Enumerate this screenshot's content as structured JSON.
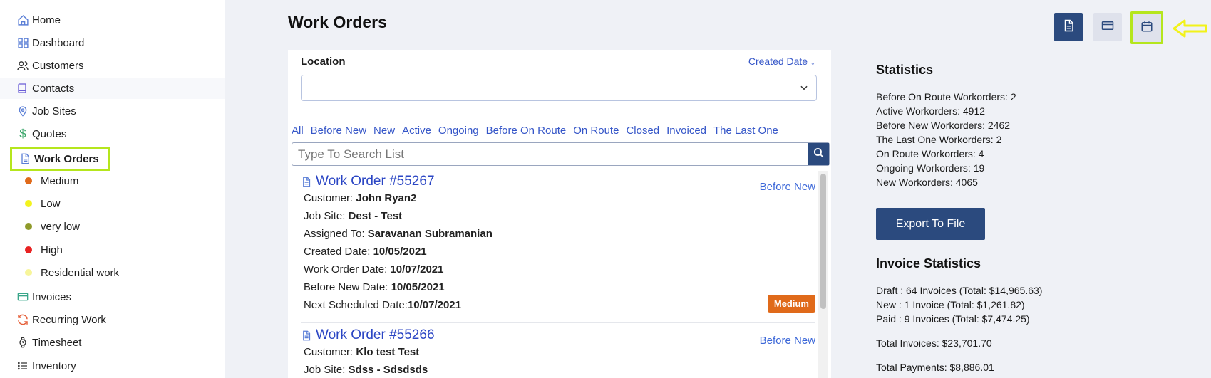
{
  "sidebar": {
    "items": [
      {
        "label": "Home",
        "icon": "home-icon"
      },
      {
        "label": "Dashboard",
        "icon": "dashboard-icon"
      },
      {
        "label": "Customers",
        "icon": "users-icon"
      },
      {
        "label": "Contacts",
        "icon": "book-icon"
      },
      {
        "label": "Job Sites",
        "icon": "map-pin-icon"
      },
      {
        "label": "Quotes",
        "icon": "dollar-icon"
      },
      {
        "label": "Work Orders",
        "icon": "document-icon"
      },
      {
        "label": "Invoices",
        "icon": "credit-card-icon"
      },
      {
        "label": "Recurring Work",
        "icon": "refresh-icon"
      },
      {
        "label": "Timesheet",
        "icon": "watch-icon"
      },
      {
        "label": "Inventory",
        "icon": "list-icon"
      }
    ],
    "priorities": [
      {
        "label": "Medium",
        "color": "#e06a1a"
      },
      {
        "label": "Low",
        "color": "#f3f31c"
      },
      {
        "label": "very low",
        "color": "#8f9a2a"
      },
      {
        "label": "High",
        "color": "#e82222"
      },
      {
        "label": "Residential work",
        "color": "#f7f59a"
      }
    ]
  },
  "header": {
    "title": "Work Orders"
  },
  "filter": {
    "location_label": "Location",
    "sort_label": "Created Date ↓",
    "location_value": "",
    "tabs": [
      "All",
      "Before New",
      "New",
      "Active",
      "Ongoing",
      "Before On Route",
      "On Route",
      "Closed",
      "Invoiced",
      "The Last One"
    ],
    "selected_tab": "Before New",
    "search_placeholder": "Type To Search List"
  },
  "work_orders": [
    {
      "title": "Work Order #55267",
      "status": "Before New",
      "priority": "Medium",
      "fields": [
        {
          "label": "Customer: ",
          "value": "John Ryan2"
        },
        {
          "label": "Job Site: ",
          "value": "Dest - Test"
        },
        {
          "label": "Assigned To: ",
          "value": "Saravanan Subramanian"
        },
        {
          "label": "Created Date: ",
          "value": "10/05/2021"
        },
        {
          "label": "Work Order Date: ",
          "value": "10/07/2021"
        },
        {
          "label": "Before New Date: ",
          "value": "10/05/2021"
        },
        {
          "label": "Next Scheduled Date:",
          "value": "10/07/2021"
        }
      ]
    },
    {
      "title": "Work Order #55266",
      "status": "Before New",
      "fields": [
        {
          "label": "Customer: ",
          "value": "Klo test Test"
        },
        {
          "label": "Job Site: ",
          "value": "Sdss - Sdsdsds"
        }
      ]
    }
  ],
  "statistics": {
    "title": "Statistics",
    "lines": [
      "Before On Route Workorders: 2",
      "Active Workorders: 4912",
      "Before New Workorders: 2462",
      "The Last One Workorders: 2",
      "On Route Workorders: 4",
      "Ongoing Workorders: 19",
      "New Workorders: 4065"
    ],
    "export_label": "Export To File"
  },
  "invoice_statistics": {
    "title": "Invoice Statistics",
    "lines": [
      "Draft : 64 Invoices (Total: $14,965.63)",
      "New : 1 Invoice (Total: $1,261.82)",
      "Paid : 9 Invoices (Total: $7,474.25)"
    ],
    "total_invoices": "Total Invoices: $23,701.70",
    "total_payments": "Total Payments: $8,886.01"
  },
  "colors": {
    "accent": "#2b4a7e",
    "link": "#3556c8",
    "highlight": "#b5e61d"
  }
}
